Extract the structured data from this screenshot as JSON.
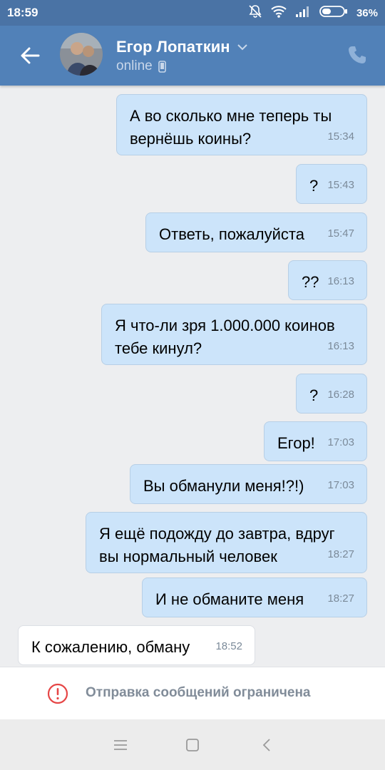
{
  "status_bar": {
    "time": "18:59",
    "battery": "36%",
    "icons": [
      "mute-icon",
      "wifi-icon",
      "signal-icon",
      "battery-icon"
    ]
  },
  "header": {
    "contact_name": "Егор Лопаткин",
    "status": "online",
    "colors": {
      "header_bg": "#5181b8",
      "status_bg": "#4a73a5"
    }
  },
  "messages": [
    {
      "dir": "out",
      "text": "А во сколько мне теперь ты вернёшь коины?",
      "time": "15:34"
    },
    {
      "dir": "out",
      "text": "?",
      "time": "15:43"
    },
    {
      "dir": "out",
      "text": "Ответь, пожалуйста",
      "time": "15:47"
    },
    {
      "dir": "out",
      "text": "??",
      "time": "16:13"
    },
    {
      "dir": "out",
      "text": "Я что-ли зря 1.000.000 коинов тебе кинул?",
      "time": "16:13"
    },
    {
      "dir": "out",
      "text": "?",
      "time": "16:28"
    },
    {
      "dir": "out",
      "text": "Егор!",
      "time": "17:03"
    },
    {
      "dir": "out",
      "text": "Вы обманули меня!?!)",
      "time": "17:03"
    },
    {
      "dir": "out",
      "text": "Я ещё подожду до завтра, вдруг вы нормальный человек",
      "time": "18:27"
    },
    {
      "dir": "out",
      "text": "И не обманите меня",
      "time": "18:27"
    },
    {
      "dir": "in",
      "text": "К сожалению, обману",
      "time": "18:52"
    }
  ],
  "restricted_bar": {
    "label": "Отправка сообщений ограничена",
    "icon": "warning-icon",
    "color": "#e64646"
  },
  "nav_bar": {
    "buttons": [
      "menu-icon",
      "home-icon",
      "back-icon"
    ]
  }
}
